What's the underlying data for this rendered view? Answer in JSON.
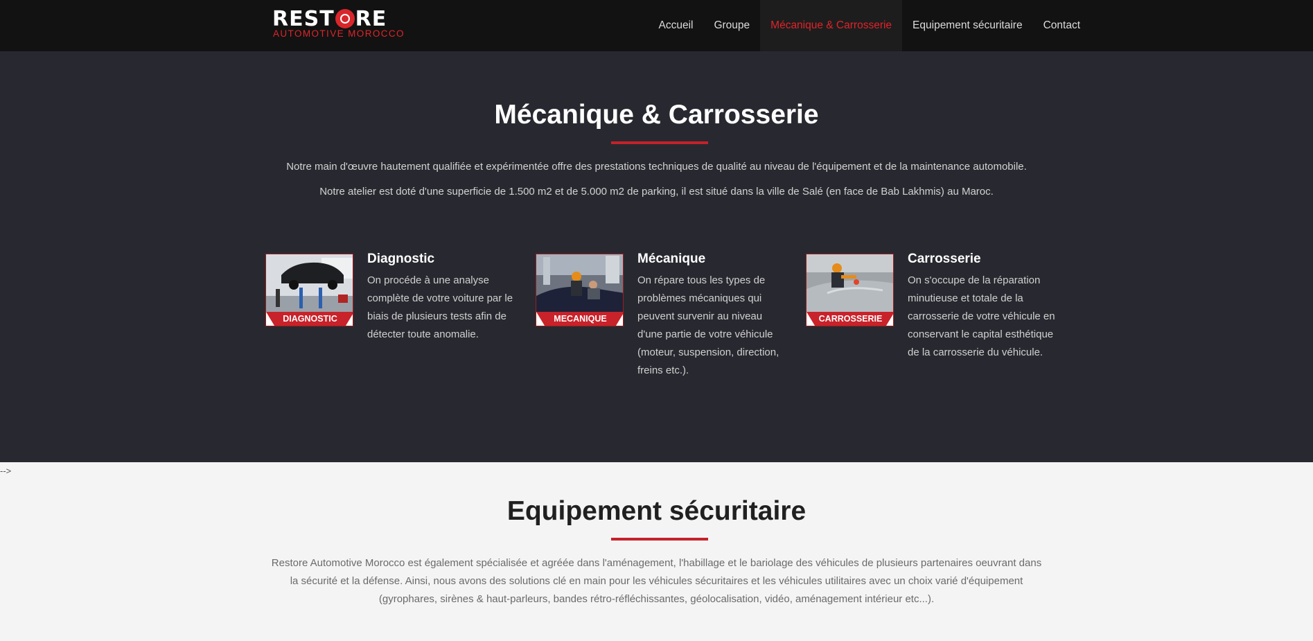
{
  "brand": {
    "logo_part_1": "REST",
    "logo_part_2": "RE",
    "logo_subtitle": "AUTOMOTIVE MOROCCO"
  },
  "nav": {
    "items": [
      {
        "label": "Accueil",
        "active": false
      },
      {
        "label": "Groupe",
        "active": false
      },
      {
        "label": "Mécanique & Carrosserie",
        "active": true
      },
      {
        "label": "Equipement sécuritaire",
        "active": false
      },
      {
        "label": "Contact",
        "active": false
      }
    ]
  },
  "mecanique_section": {
    "title": "Mécanique & Carrosserie",
    "paragraphs": [
      "Notre main d'œuvre hautement qualifiée et expérimentée offre des prestations techniques de qualité au niveau de l'équipement et de la maintenance automobile.",
      "Notre atelier est doté d'une superficie de 1.500 m2 et de 5.000 m2 de parking, il est situé dans la ville de Salé (en face de Bab Lakhmis) au Maroc."
    ],
    "cards": [
      {
        "image_label": "DIAGNOSTIC",
        "title": "Diagnostic",
        "text": "On procéde à une analyse complète de votre voiture par le biais de plusieurs tests afin de détecter toute anomalie."
      },
      {
        "image_label": "MECANIQUE",
        "title": "Mécanique",
        "text": "On répare tous les types de problèmes mécaniques qui peuvent survenir au niveau d'une partie de votre véhicule (moteur, suspension, direction, freins etc.)."
      },
      {
        "image_label": "CARROSSERIE",
        "title": "Carrosserie",
        "text": "On s'occupe de la réparation minutieuse et totale de la carrosserie de votre véhicule en conservant le capital esthétique de la carrosserie du véhicule."
      }
    ]
  },
  "stray_text": "-->",
  "equipement_section": {
    "title": "Equipement sécuritaire",
    "paragraph": "Restore Automotive Morocco est également spécialisée et agréée dans l'aménagement, l'habillage et le bariolage des véhicules de plusieurs partenaires oeuvrant dans la sécurité et la défense. Ainsi, nous avons des solutions clé en main pour les véhicules sécuritaires et les véhicules utilitaires avec un choix varié d'équipement (gyrophares, sirènes & haut-parleurs, bandes rétro-réfléchissantes, géolocalisation, vidéo, aménagement intérieur etc...)."
  },
  "colors": {
    "accent_red": "#d8262b",
    "navbar_bg": "#121212",
    "dark_section_bg": "#282930",
    "light_section_bg": "#f4f4f4"
  }
}
